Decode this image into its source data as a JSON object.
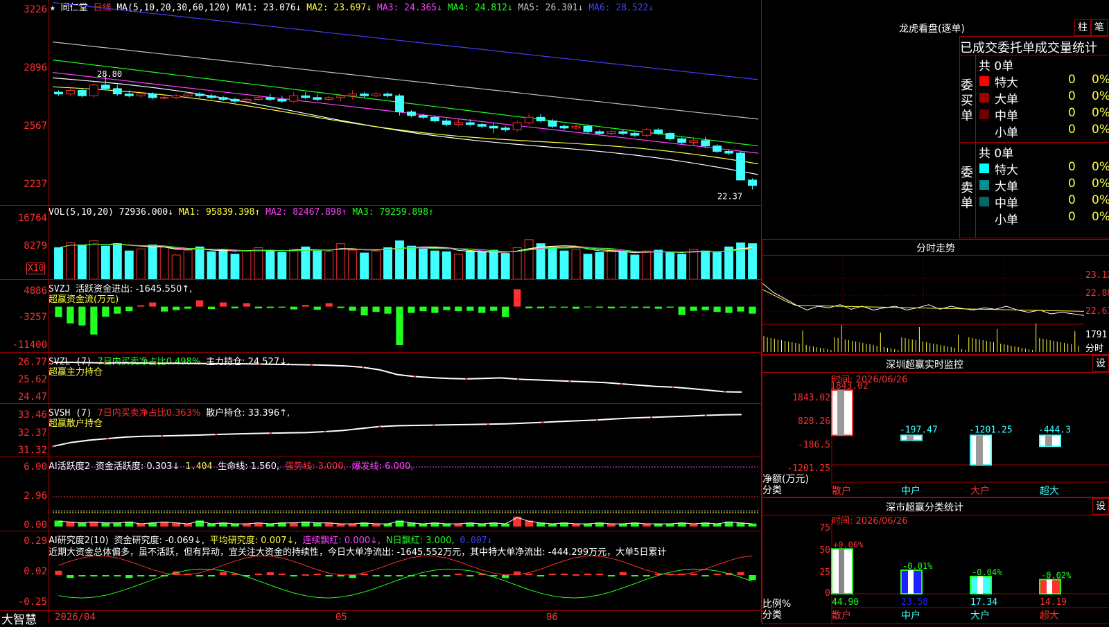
{
  "main_chart": {
    "star": "★",
    "stock_name": "同仁堂",
    "period": "日线",
    "ma_params": "MA(5,10,20,30,60,120)",
    "ma_values": [
      {
        "label": "MA1: 23.076↓",
        "color": "#ffffff"
      },
      {
        "label": "MA2: 23.697↓",
        "color": "#ffff40"
      },
      {
        "label": "MA3: 24.365↓",
        "color": "#ff40ff"
      },
      {
        "label": "MA4: 24.812↓",
        "color": "#20ff20"
      },
      {
        "label": "MA5: 26.301↓",
        "color": "#c0c0c0"
      },
      {
        "label": "MA6: 28.522↓",
        "color": "#4040ff"
      }
    ],
    "y_ticks": [
      "3226",
      "2896",
      "2567",
      "2237"
    ],
    "high_label": "28.80",
    "low_label": "22.37"
  },
  "vol_panel": {
    "title": "VOL(5,10,20)",
    "vol": "72936.000↓",
    "ma1": "MA1: 95839.398↑",
    "ma2": "MA2: 82467.898↑",
    "ma3": "MA3: 79259.898↑",
    "y_ticks": [
      "16764",
      "8279"
    ],
    "unit": "X10"
  },
  "svzj_panel": {
    "name": "SVZJ",
    "text": "活跃资金进出: -1645.550↑,",
    "subtitle": "超赢资金流(万元)",
    "y_ticks": [
      "4886",
      "-3257",
      "-11400"
    ]
  },
  "svzl_panel": {
    "name": "SVZL (7)",
    "ratio": "7日内买卖净占比0.498%",
    "hold": "主力持仓: 24.527↓,",
    "subtitle": "超赢主力持仓",
    "y_ticks": [
      "26.77",
      "25.62",
      "24.47"
    ]
  },
  "svsh_panel": {
    "name": "SVSH (7)",
    "ratio": "7日内买卖净占比0.363%",
    "hold": "散户持仓: 33.396↑,",
    "subtitle": "超赢散户持仓",
    "y_ticks": [
      "33.46",
      "32.37",
      "31.32"
    ]
  },
  "ai_active_panel": {
    "name": "AI活跃度2",
    "text1": "资金活跃度: 0.303↓",
    "text2": "1.404",
    "text3": "生命线: 1.560,",
    "text4": "强势线: 3.000,",
    "text5": "爆发线: 6.000,",
    "y_ticks": [
      "6.00",
      "2.96",
      "0.00"
    ]
  },
  "ai_research_panel": {
    "name": "AI研究度2(10)",
    "text1": "资金研究度: -0.069↓,",
    "text2": "平均研究度: 0.007↓,",
    "text3": "连续飘红: 0.000↓,",
    "text4": "N日飘红: 3.000,",
    "text5": "0.007↓",
    "comment": "近期大资金总体偏多，虽不活跃，但有异动，宜关注大资金的持续性，今日大单净流出: -1645.552万元，其中特大单净流出: -444.299万元，大单5日累计",
    "y_ticks": [
      "0.29",
      "0.02",
      "-0.25"
    ]
  },
  "x_axis": {
    "brand": "大智慧",
    "labels": [
      "2026/04",
      "05",
      "06"
    ]
  },
  "dragon_tiger": {
    "title": "龙虎看盘(逐单)",
    "btn1": "柱",
    "btn2": "笔",
    "table_header": "已成交委托单成交量统计",
    "buy_label": "委买单",
    "sell_label": "委卖单",
    "buy_total": "共 0单",
    "sell_total": "共 0单",
    "buy_rows": [
      {
        "name": "特大",
        "count": "0",
        "pct": "0%",
        "color": "#ff0000"
      },
      {
        "name": "大单",
        "count": "0",
        "pct": "0%",
        "color": "#a00000"
      },
      {
        "name": "中单",
        "count": "0",
        "pct": "0%",
        "color": "#700000"
      },
      {
        "name": "小单",
        "count": "0",
        "pct": "0%",
        "color": "#000000"
      }
    ],
    "sell_rows": [
      {
        "name": "特大",
        "count": "0",
        "pct": "0%",
        "color": "#00ffff"
      },
      {
        "name": "大单",
        "count": "0",
        "pct": "0%",
        "color": "#009090"
      },
      {
        "name": "中单",
        "count": "0",
        "pct": "0%",
        "color": "#006868"
      },
      {
        "name": "小单",
        "count": "0",
        "pct": "0%",
        "color": "#000000"
      }
    ]
  },
  "intraday": {
    "title": "分时走势",
    "y_ticks": [
      "23.12",
      "22.88",
      "22.63"
    ],
    "vol_tick": "1791",
    "vol_label": "分时"
  },
  "sz_monitor": {
    "title": "深圳超赢实时监控",
    "btn": "设",
    "date": "时间: 2026/06/26",
    "y_ticks": [
      "1843.02",
      "828.26",
      "-186.5",
      "-1201.25"
    ],
    "axis_label1": "净额(万元)",
    "axis_label2": "分类"
  },
  "sz_stats": {
    "title": "深市超赢分类统计",
    "btn": "设",
    "date": "时间: 2026/06/26",
    "y_ticks": [
      "75",
      "50",
      "25",
      "0"
    ],
    "axis_label1": "比例%",
    "axis_label2": "分类"
  },
  "chart_data": [
    {
      "type": "candlestick",
      "title": "同仁堂 日线",
      "x_labels": [
        "2026/04",
        "05",
        "06"
      ],
      "ohlc": [
        [
          27.8,
          27.9,
          27.6,
          27.7
        ],
        [
          27.7,
          28.0,
          27.6,
          27.9
        ],
        [
          27.9,
          28.0,
          27.5,
          27.6
        ],
        [
          27.6,
          28.3,
          27.5,
          28.2
        ],
        [
          28.2,
          28.8,
          27.9,
          28.0
        ],
        [
          28.0,
          28.2,
          27.6,
          27.7
        ],
        [
          27.7,
          27.9,
          27.5,
          27.6
        ],
        [
          27.6,
          27.8,
          27.5,
          27.7
        ],
        [
          27.7,
          27.8,
          27.4,
          27.5
        ],
        [
          27.5,
          27.6,
          27.4,
          27.5
        ],
        [
          27.5,
          27.7,
          27.4,
          27.6
        ],
        [
          27.6,
          27.8,
          27.5,
          27.7
        ],
        [
          27.7,
          27.8,
          27.5,
          27.6
        ],
        [
          27.6,
          27.7,
          27.4,
          27.5
        ],
        [
          27.5,
          27.6,
          27.3,
          27.4
        ],
        [
          27.4,
          27.5,
          27.2,
          27.3
        ],
        [
          27.3,
          27.5,
          27.2,
          27.4
        ],
        [
          27.4,
          27.6,
          27.3,
          27.5
        ],
        [
          27.5,
          27.7,
          27.3,
          27.4
        ],
        [
          27.4,
          27.6,
          27.2,
          27.3
        ],
        [
          27.3,
          27.8,
          27.2,
          27.6
        ],
        [
          27.6,
          27.8,
          27.4,
          27.5
        ],
        [
          27.5,
          27.7,
          27.3,
          27.4
        ],
        [
          27.4,
          27.6,
          27.3,
          27.5
        ],
        [
          27.5,
          27.7,
          27.3,
          27.6
        ],
        [
          27.6,
          27.9,
          27.4,
          27.7
        ],
        [
          27.7,
          27.8,
          27.5,
          27.6
        ],
        [
          27.6,
          27.8,
          27.5,
          27.7
        ],
        [
          27.7,
          27.8,
          27.5,
          27.6
        ],
        [
          27.6,
          27.7,
          26.5,
          26.7
        ],
        [
          26.7,
          26.8,
          26.4,
          26.5
        ],
        [
          26.5,
          26.6,
          26.3,
          26.4
        ],
        [
          26.4,
          26.5,
          26.1,
          26.2
        ],
        [
          26.2,
          26.3,
          25.9,
          26.0
        ],
        [
          26.0,
          26.3,
          25.9,
          26.1
        ],
        [
          26.1,
          26.3,
          25.9,
          26.0
        ],
        [
          26.0,
          26.1,
          25.8,
          25.9
        ],
        [
          25.9,
          26.1,
          25.5,
          25.8
        ],
        [
          25.8,
          25.9,
          25.6,
          25.7
        ],
        [
          25.7,
          26.2,
          25.6,
          26.1
        ],
        [
          26.1,
          26.6,
          26.0,
          26.4
        ],
        [
          26.4,
          26.6,
          26.1,
          26.2
        ],
        [
          26.2,
          26.3,
          25.8,
          25.9
        ],
        [
          25.9,
          26.0,
          25.7,
          25.8
        ],
        [
          25.8,
          26.0,
          25.7,
          25.9
        ],
        [
          25.9,
          26.0,
          25.5,
          25.6
        ],
        [
          25.6,
          25.7,
          25.4,
          25.5
        ],
        [
          25.5,
          25.7,
          25.4,
          25.6
        ],
        [
          25.6,
          25.7,
          25.4,
          25.5
        ],
        [
          25.5,
          25.6,
          25.3,
          25.4
        ],
        [
          25.4,
          25.8,
          25.3,
          25.7
        ],
        [
          25.7,
          25.8,
          25.4,
          25.5
        ],
        [
          25.5,
          25.6,
          25.1,
          25.2
        ],
        [
          25.2,
          25.3,
          24.9,
          25.0
        ],
        [
          25.0,
          25.3,
          24.8,
          25.1
        ],
        [
          25.1,
          25.3,
          24.7,
          24.8
        ],
        [
          24.8,
          24.9,
          24.4,
          24.5
        ],
        [
          24.5,
          24.6,
          24.3,
          24.4
        ],
        [
          24.4,
          24.5,
          22.9,
          22.9
        ],
        [
          22.9,
          23.0,
          22.37,
          22.6
        ]
      ],
      "ma_series": [
        {
          "name": "MA1",
          "color": "#ffffff",
          "start": 28.6,
          "end": 23.1
        },
        {
          "name": "MA2",
          "color": "#ffff40",
          "start": 28.1,
          "end": 23.7
        },
        {
          "name": "MA3",
          "color": "#ff40ff",
          "start": 28.9,
          "end": 24.4
        },
        {
          "name": "MA4",
          "color": "#20ff20",
          "start": 29.6,
          "end": 24.8
        },
        {
          "name": "MA5",
          "color": "#c0c0c0",
          "start": 30.6,
          "end": 26.3
        },
        {
          "name": "MA6",
          "color": "#4040ff",
          "start": 32.8,
          "end": 28.5
        }
      ],
      "ylim": [
        22.2,
        32.4
      ],
      "high": 28.8,
      "low": 22.37
    },
    {
      "type": "bar",
      "title": "VOL(5,10,20)",
      "values": [
        78,
        90,
        85,
        95,
        82,
        88,
        70,
        75,
        85,
        80,
        60,
        72,
        80,
        68,
        74,
        62,
        70,
        78,
        72,
        66,
        74,
        80,
        70,
        68,
        88,
        72,
        65,
        70,
        78,
        95,
        82,
        75,
        70,
        68,
        62,
        70,
        66,
        72,
        64,
        78,
        98,
        88,
        80,
        70,
        74,
        62,
        66,
        72,
        68,
        60,
        70,
        72,
        66,
        62,
        74,
        70,
        66,
        80,
        90,
        88
      ],
      "ylim": [
        0,
        175
      ]
    },
    {
      "type": "bar",
      "title": "超赢资金流(万元)",
      "values": [
        -3000,
        -4800,
        -5400,
        -8000,
        -2900,
        -2000,
        -1300,
        400,
        1200,
        -1400,
        -1000,
        -600,
        1800,
        -700,
        1200,
        -500,
        1000,
        -500,
        -400,
        -300,
        -800,
        500,
        -900,
        1000,
        -400,
        -1200,
        -2500,
        -1500,
        -2000,
        -11000,
        -1800,
        -1300,
        -1800,
        -1000,
        -1300,
        -1200,
        -1800,
        -1200,
        -3000,
        5000,
        -500,
        -500,
        -300,
        -300,
        -600,
        -200,
        -300,
        -500,
        -300,
        -400,
        -400,
        -600,
        -300,
        -2400,
        -1200,
        -1000,
        -1500,
        -1800,
        -1400,
        -2000
      ],
      "ylim": [
        -11400,
        4886
      ]
    },
    {
      "type": "line",
      "title": "超赢主力持仓",
      "values": [
        26.77,
        26.77,
        26.75,
        26.72,
        26.74,
        26.72,
        26.7,
        26.7,
        26.69,
        26.68,
        26.66,
        26.66,
        26.64,
        26.62,
        26.6,
        26.58,
        26.55,
        26.5,
        26.4,
        26.2,
        25.85,
        25.7,
        25.62,
        25.55,
        25.52,
        25.55,
        25.6,
        25.5,
        25.45,
        25.4,
        25.35,
        25.3,
        25.25,
        25.15,
        25.05,
        24.95,
        24.9,
        24.8,
        24.68,
        24.55,
        24.527
      ],
      "ylim": [
        24.47,
        26.77
      ]
    },
    {
      "type": "line",
      "title": "超赢散户持仓",
      "values": [
        31.35,
        31.6,
        31.75,
        31.85,
        31.95,
        32.0,
        32.02,
        32.05,
        32.08,
        32.12,
        32.15,
        32.18,
        32.2,
        32.22,
        32.24,
        32.3,
        32.37,
        32.5,
        32.62,
        32.68,
        32.7,
        32.72,
        32.74,
        32.76,
        32.78,
        32.8,
        32.85,
        32.9,
        32.95,
        33.0,
        33.05,
        33.12,
        33.18,
        33.22,
        33.26,
        33.3,
        33.35,
        33.38,
        33.396
      ],
      "ylim": [
        31.32,
        33.46
      ]
    },
    {
      "type": "bar",
      "title": "AI活跃度2",
      "values": [
        0.6,
        0.5,
        0.4,
        0.5,
        0.4,
        0.4,
        0.5,
        0.3,
        0.4,
        0.5,
        0.4,
        0.3,
        0.6,
        0.3,
        0.4,
        0.3,
        0.3,
        0.4,
        0.3,
        0.4,
        0.4,
        0.5,
        0.4,
        0.4,
        0.3,
        0.3,
        0.4,
        0.3,
        0.3,
        0.6,
        0.4,
        0.3,
        0.4,
        0.3,
        0.3,
        0.4,
        0.3,
        0.4,
        0.3,
        1.0,
        0.6,
        0.4,
        0.3,
        0.4,
        0.3,
        0.3,
        0.4,
        0.3,
        0.3,
        0.4,
        0.3,
        0.3,
        0.3,
        0.4,
        0.3,
        0.4,
        0.3,
        0.5,
        0.4,
        0.303
      ],
      "lines": {
        "1.404": 1.404,
        "生命线": 1.56,
        "强势线": 3.0,
        "爆发线": 6.0
      },
      "ylim": [
        0,
        6.0
      ]
    },
    {
      "type": "bar",
      "title": "AI研究度2(10)",
      "values": [
        0.06,
        -0.04,
        -0.02,
        -0.02,
        -0.02,
        -0.02,
        -0.04,
        -0.02,
        -0.02,
        -0.02,
        0.05,
        0.02,
        -0.02,
        -0.02,
        0.04,
        0.02,
        -0.02,
        0.02,
        0.04,
        0.02,
        -0.02,
        0.01,
        0.02,
        -0.02,
        -0.02,
        -0.04,
        0.02,
        -0.02,
        -0.02,
        -0.02,
        -0.02,
        -0.02,
        -0.02,
        -0.02,
        0.02,
        -0.02,
        0.02,
        -0.02,
        -0.04,
        0.05,
        0.02,
        -0.02,
        0.02,
        0.02,
        0.01,
        0.02,
        0.02,
        -0.02,
        0.04,
        -0.02,
        -0.02,
        0.02,
        0.02,
        0.02,
        0.02,
        -0.02,
        0.02,
        0.03,
        0.04,
        -0.069
      ],
      "ylim": [
        -0.25,
        0.29
      ]
    },
    {
      "type": "line",
      "title": "分时走势",
      "values": [
        22.9,
        22.78,
        22.7,
        22.62,
        22.55,
        22.6,
        22.58,
        22.62,
        22.56,
        22.6,
        22.55,
        22.58,
        22.6,
        22.55,
        22.58,
        22.62,
        22.56,
        22.6,
        22.57,
        22.55,
        22.58,
        22.56,
        22.6,
        22.55,
        22.52,
        22.55,
        22.5,
        22.52,
        22.5,
        22.48
      ],
      "ylim": [
        22.4,
        23.2
      ]
    },
    {
      "type": "bar",
      "title": "深圳超赢实时监控",
      "categories": [
        "散户",
        "中户",
        "大户",
        "超大"
      ],
      "values": [
        1843.02,
        -197.47,
        -1201.25,
        -444.3
      ],
      "ylim": [
        -1201.25,
        1843.02
      ]
    },
    {
      "type": "bar",
      "title": "深市超赢分类统计",
      "categories": [
        "散户",
        "中户",
        "大户",
        "超大"
      ],
      "values": [
        44.9,
        23.58,
        17.34,
        14.19
      ],
      "changes": [
        "+0.06%",
        "-0.01%",
        "-0.04%",
        "-0.02%"
      ],
      "ylim": [
        0,
        75
      ]
    }
  ]
}
